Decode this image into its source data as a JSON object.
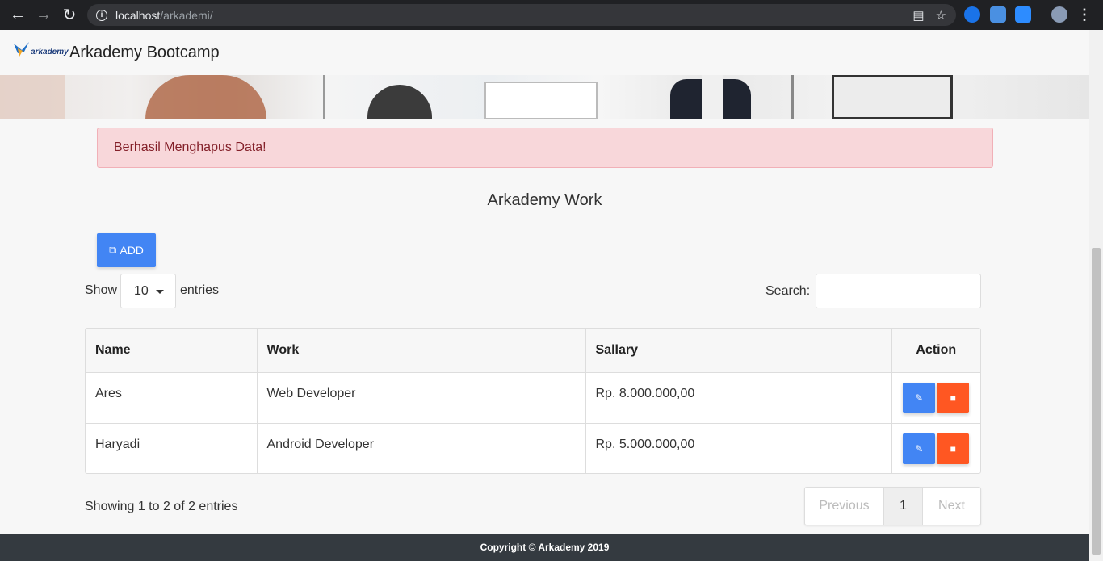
{
  "browser": {
    "url_host": "localhost",
    "url_path": "/arkademi/"
  },
  "navbar": {
    "logo_text": "arkademy",
    "brand": "Arkademy Bootcamp"
  },
  "alert": {
    "message": "Berhasil Menghapus Data!"
  },
  "page": {
    "title": "Arkademy Work",
    "add_label": "ADD"
  },
  "table_controls": {
    "show_label": "Show",
    "entries_value": "10",
    "entries_label": "entries",
    "search_label": "Search:",
    "search_value": ""
  },
  "table": {
    "headers": [
      "Name",
      "Work",
      "Sallary",
      "Action"
    ],
    "rows": [
      {
        "name": "Ares",
        "work": "Web Developer",
        "salary": "Rp. 8.000.000,00"
      },
      {
        "name": "Haryadi",
        "work": "Android Developer",
        "salary": "Rp. 5.000.000,00"
      }
    ]
  },
  "pagination": {
    "info": "Showing 1 to 2 of 2 entries",
    "previous": "Previous",
    "page": "1",
    "next": "Next"
  },
  "footer": {
    "copyright": "Copyright © Arkademy 2019"
  },
  "icons": {
    "edit": "edit-icon",
    "delete": "trash-icon",
    "add": "external-link-icon"
  },
  "colors": {
    "primary": "#4285f4",
    "danger": "#ff5722",
    "alert_bg": "#f8d7da",
    "footer_bg": "#343a40"
  }
}
